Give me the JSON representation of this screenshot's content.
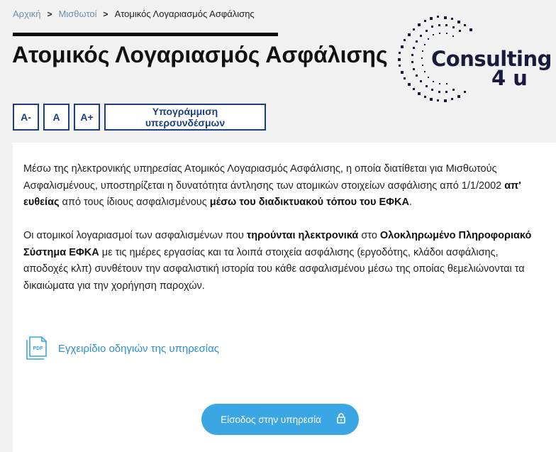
{
  "breadcrumb": {
    "home": "Αρχική",
    "parent": "Μισθωτοί",
    "current": "Ατομικός Λογαριασμός Ασφάλισης"
  },
  "page": {
    "title": "Ατομικός Λογαριασμός Ασφάλισης"
  },
  "logo": {
    "text_main": "Consulting",
    "text_sub": "4 u"
  },
  "toolbar": {
    "decrease_font": "A-",
    "normal_font": "A",
    "increase_font": "A+",
    "underline_links": "Υπογράμμιση υπερσυνδέσμων"
  },
  "content": {
    "para1": {
      "part1": "Μέσω της ηλεκτρονικής υπηρεσίας Ατομικός Λογαριασμός Ασφάλισης, η οποία διατίθεται για Μισθωτούς Ασφαλισμένους, υποστηρίζεται η δυνατότητα άντλησης των ατομικών στοιχείων ασφάλισης από 1/1/2002 ",
      "bold1": "απ' ευθείας",
      "part2": " από τους ίδιους ασφαλισμένους ",
      "bold2": "μέσω του διαδικτυακού τόπου του ΕΦΚΑ",
      "part3": "."
    },
    "para2": {
      "part1": "Οι ατομικοί λογαριασμοί των ασφαλισμένων που ",
      "bold1": "τηρούνται ηλεκτρονικά",
      "part2": " στο ",
      "bold2": "Ολοκληρωμένο Πληροφοριακό Σύστημα ΕΦΚΑ",
      "part3": " με τις ημέρες εργασίας και τα λοιπά στοιχεία ασφάλισης (εργοδότης, κλάδοι ασφάλισης, αποδοχές κλπ) συνθέτουν την ασφαλιστική ιστορία του κάθε ασφαλισμένου μέσω της οποίας θεμελιώνονται τα δικαιώματα για την χορήγηση παροχών."
    },
    "manual_link": "Εγχειρίδιο οδηγιών της υπηρεσίας",
    "pdf_icon_label": "PDF",
    "login_button": "Είσοδος στην υπηρεσία"
  },
  "colors": {
    "accent_dark": "#1d3f7a",
    "link_blue": "#2b8fd0",
    "button_blue": "#3aa6e3",
    "logo_navy": "#1a1a3a"
  },
  "icons": {
    "breadcrumb_separator": "chevron-right-icon",
    "pdf": "pdf-document-icon",
    "login": "lock-icon"
  }
}
